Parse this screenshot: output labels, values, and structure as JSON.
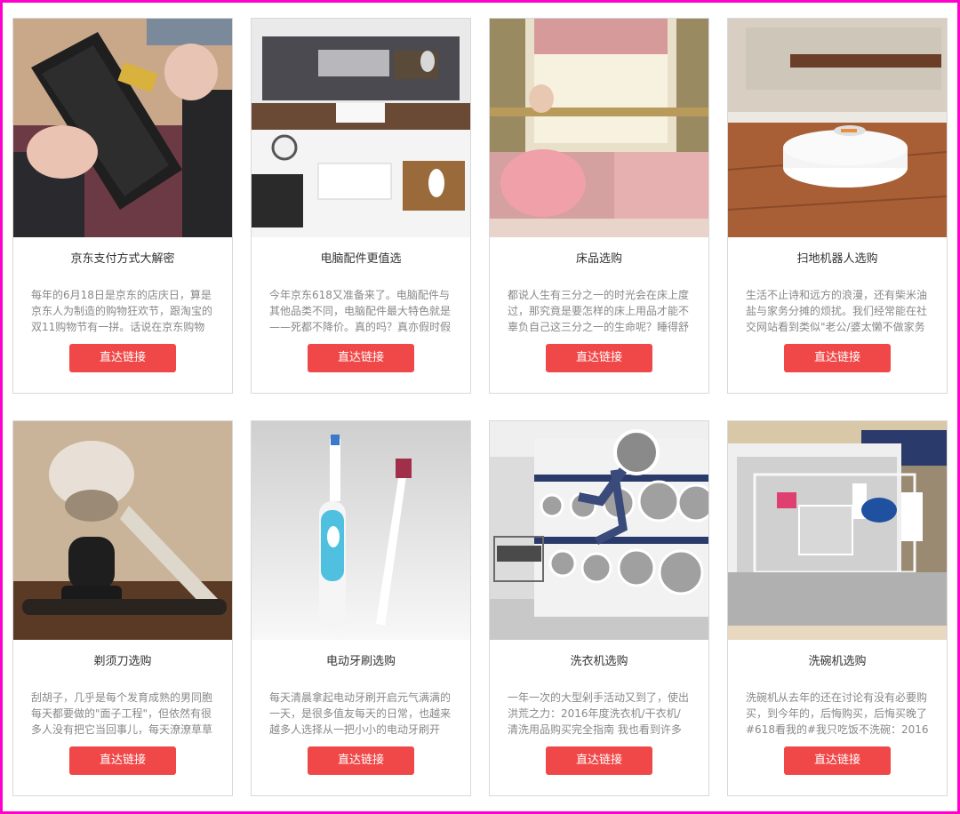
{
  "cards": [
    {
      "title": "京东支付方式大解密",
      "desc": "每年的6月18日是京东的店庆日，算是京东人为制造的购物狂欢节，跟淘宝的双11购物节有一拼。话说在京东购物也",
      "button": "直达链接",
      "image_icon": "wallet-photo-icon"
    },
    {
      "title": "电脑配件更值选",
      "desc": "今年京东618又准备来了。电脑配件与其他品类不同，电脑配件最大特色就是——死都不降价。真的吗？真亦假时假",
      "button": "直达链接",
      "image_icon": "desk-computer-photo-icon"
    },
    {
      "title": "床品选购",
      "desc": "都说人生有三分之一的时光会在床上度过，那究竟是要怎样的床上用品才能不辜负自己这三分之一的生命呢？睡得舒",
      "button": "直达链接",
      "image_icon": "bedroom-photo-icon"
    },
    {
      "title": "扫地机器人选购",
      "desc": "生活不止诗和远方的浪漫，还有柴米油盐与家务分摊的烦扰。我们经常能在社交网站看到类似\"老公/婆太懒不做家务",
      "button": "直达链接",
      "image_icon": "robot-vacuum-photo-icon"
    },
    {
      "title": "剃须刀选购",
      "desc": "刮胡子，几乎是每个发育成熟的男同胞每天都要做的\"面子工程\"，但依然有很多人没有把它当回事儿，每天潦潦草草",
      "button": "直达链接",
      "image_icon": "shaving-brush-photo-icon"
    },
    {
      "title": "电动牙刷选购",
      "desc": "每天清晨拿起电动牙刷开启元气满满的一天，是很多值友每天的日常，也越来越多人选择从一把小小的电动牙刷开",
      "button": "直达链接",
      "image_icon": "electric-toothbrush-photo-icon"
    },
    {
      "title": "洗衣机选购",
      "desc": "一年一次的大型剁手活动又到了，使出洪荒之力：2016年度洗衣机/干衣机/清洗用品购买完全指南 我也看到许多小",
      "button": "直达链接",
      "image_icon": "laundromat-photo-icon"
    },
    {
      "title": "洗碗机选购",
      "desc": "洗碗机从去年的还在讨论有没有必要购买，到今年的，后悔购买，后悔买晚了#618看我的#我只吃饭不洗碗：2016",
      "button": "直达链接",
      "image_icon": "dishwasher-photo-icon"
    }
  ],
  "colors": {
    "button_bg": "#f04848",
    "frame_border": "#ff00cc"
  }
}
